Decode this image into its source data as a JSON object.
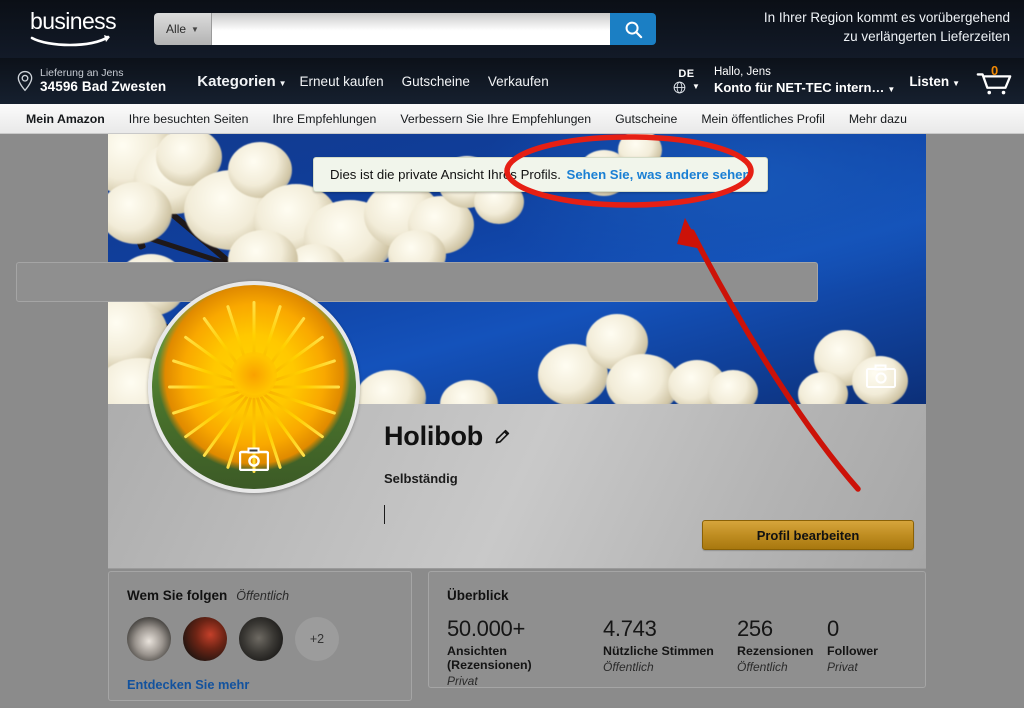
{
  "header": {
    "logo_word": "business",
    "logo_icon": "amazon-smile-icon",
    "search": {
      "category": "Alle",
      "value": "",
      "placeholder": "",
      "button_icon": "search-icon"
    },
    "region_notice_line1": "In Ihrer Region kommt es vorübergehend",
    "region_notice_line2": "zu verlängerten Lieferzeiten",
    "delivery": {
      "icon": "location-pin-icon",
      "line1": "Lieferung an Jens",
      "line2": "34596 Bad Zwesten"
    },
    "nav_links": [
      {
        "label": "Kategorien",
        "has_caret": true,
        "bold": true
      },
      {
        "label": "Erneut kaufen",
        "has_caret": false,
        "bold": false
      },
      {
        "label": "Gutscheine",
        "has_caret": false,
        "bold": false
      },
      {
        "label": "Verkaufen",
        "has_caret": false,
        "bold": false
      }
    ],
    "language": {
      "code": "DE",
      "icon": "globe-icon"
    },
    "account": {
      "line1": "Hallo, Jens",
      "line2": "Konto für NET-TEC intern…"
    },
    "lists_label": "Listen",
    "cart": {
      "icon": "shopping-cart-icon",
      "count": "0",
      "count_color": "#f08804"
    }
  },
  "subnav": {
    "items": [
      {
        "label": "Mein Amazon",
        "active": true
      },
      {
        "label": "Ihre besuchten Seiten",
        "active": false
      },
      {
        "label": "Ihre Empfehlungen",
        "active": false
      },
      {
        "label": "Verbessern Sie Ihre Empfehlungen",
        "active": false
      },
      {
        "label": "Gutscheine",
        "active": false
      },
      {
        "label": "Mein öffentliches Profil",
        "active": false
      },
      {
        "label": "Mehr dazu",
        "active": false
      }
    ]
  },
  "profile": {
    "notice_text": "Dies ist die private Ansicht Ihres Profils.",
    "notice_link": "Sehen Sie, was andere sehen",
    "banner_camera_icon": "camera-icon",
    "avatar_camera_icon": "camera-icon",
    "avatar_alt": "dandelion-flower-photo",
    "name": "Holibob",
    "name_edit_icon": "pencil-icon",
    "subtitle": "Selbständig",
    "edit_button": "Profil bearbeiten"
  },
  "follow_card": {
    "title": "Wem Sie folgen",
    "visibility": "Öffentlich",
    "avatars": [
      "follower-avatar-1",
      "follower-avatar-2",
      "follower-avatar-3"
    ],
    "more_count": "+2",
    "discover_link": "Entdecken Sie mehr"
  },
  "overview_card": {
    "title": "Überblick",
    "stats": [
      {
        "value": "50.000+",
        "label": "Ansichten (Rezensionen)",
        "visibility": "Privat"
      },
      {
        "value": "4.743",
        "label": "Nützliche Stimmen",
        "visibility": "Öffentlich"
      },
      {
        "value": "256",
        "label": "Rezensionen",
        "visibility": "Öffentlich"
      },
      {
        "value": "0",
        "label": "Follower",
        "visibility": "Privat"
      }
    ]
  },
  "annotations": {
    "ellipse_color": "#e61f14",
    "arrow_color": "#cc1208"
  }
}
